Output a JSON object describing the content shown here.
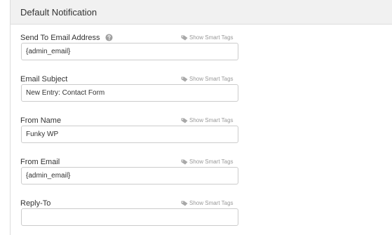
{
  "panel": {
    "title": "Default Notification"
  },
  "smart_tags_label": "Show Smart Tags",
  "fields": [
    {
      "label": "Send To Email Address",
      "value": "{admin_email}",
      "has_help": true
    },
    {
      "label": "Email Subject",
      "value": "New Entry: Contact Form"
    },
    {
      "label": "From Name",
      "value": "Funky WP"
    },
    {
      "label": "From Email",
      "value": "{admin_email}"
    },
    {
      "label": "Reply-To",
      "value": ""
    }
  ],
  "icons": {
    "help": "question-circle-icon",
    "smart_tags": "tag-icon"
  },
  "colors": {
    "header_bg": "#f1f1f1",
    "border": "#cccccc",
    "muted_text": "#999999",
    "text": "#333333"
  }
}
